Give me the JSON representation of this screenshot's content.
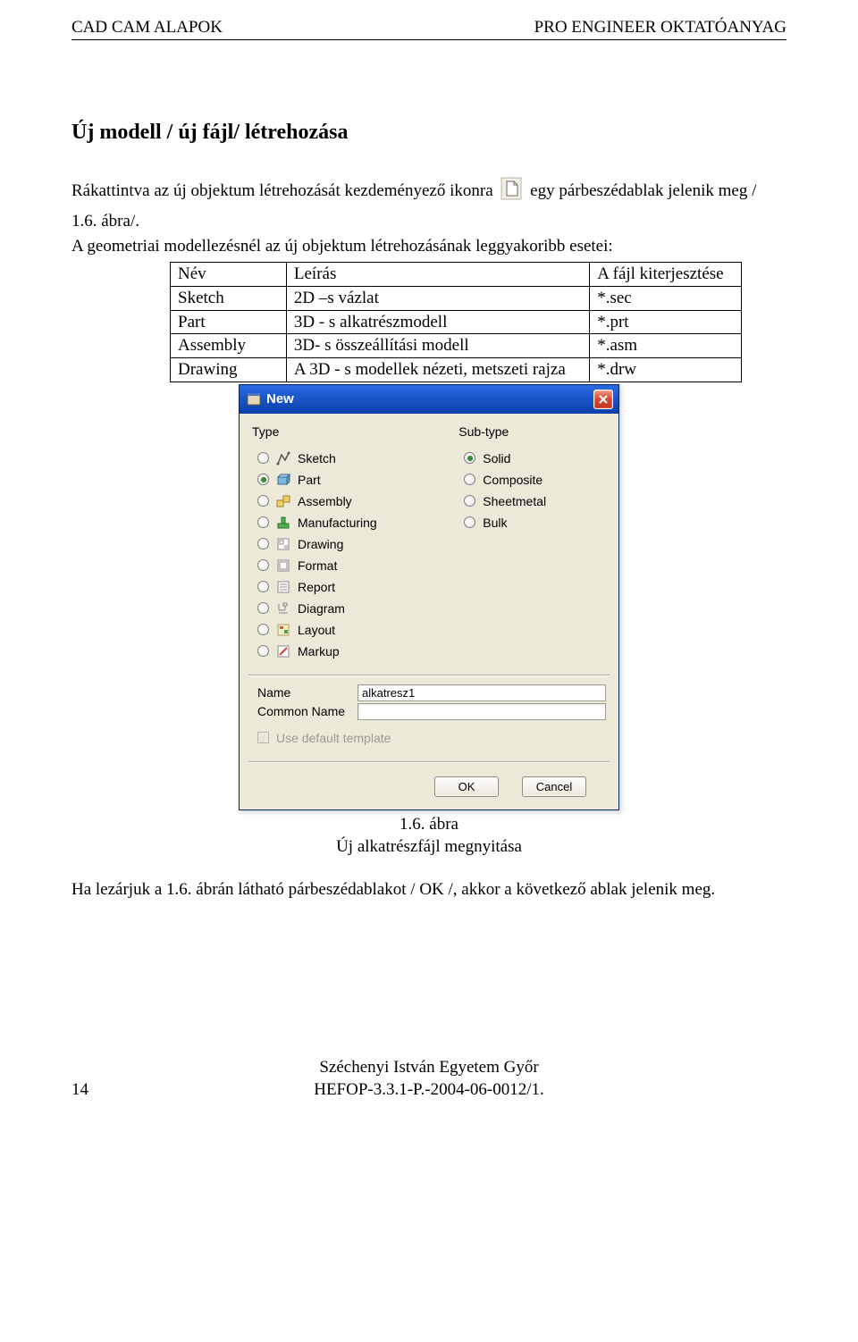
{
  "header": {
    "left": "CAD CAM ALAPOK",
    "right": "PRO ENGINEER OKTATÓANYAG"
  },
  "title": "Új modell / új fájl/ létrehozása",
  "intro": {
    "part1": "Rákattintva az új objektum létrehozását kezdeményező ikonra",
    "part2": "egy párbeszédablak jelenik meg /",
    "line2": "1.6. ábra/.",
    "line3": "A geometriai modellezésnél az új objektum létrehozásának leggyakoribb esetei:"
  },
  "def_table": {
    "rows": [
      {
        "c1": "Név",
        "c2": "Leírás",
        "c3": "A fájl kiterjesztése"
      },
      {
        "c1": "Sketch",
        "c2": "2D –s  vázlat",
        "c3": "*.sec"
      },
      {
        "c1": "Part",
        "c2": "3D - s alkatrészmodell",
        "c3": "*.prt"
      },
      {
        "c1": "Assembly",
        "c2": "3D- s összeállítási modell",
        "c3": "*.asm"
      },
      {
        "c1": "Drawing",
        "c2": "  A 3D - s modellek nézeti, metszeti rajza",
        "c3": "*.drw"
      }
    ]
  },
  "dialog": {
    "title": "New",
    "type_label": "Type",
    "subtype_label": "Sub-type",
    "types": [
      {
        "label": "Sketch",
        "selected": false
      },
      {
        "label": "Part",
        "selected": true
      },
      {
        "label": "Assembly",
        "selected": false
      },
      {
        "label": "Manufacturing",
        "selected": false
      },
      {
        "label": "Drawing",
        "selected": false
      },
      {
        "label": "Format",
        "selected": false
      },
      {
        "label": "Report",
        "selected": false
      },
      {
        "label": "Diagram",
        "selected": false
      },
      {
        "label": "Layout",
        "selected": false
      },
      {
        "label": "Markup",
        "selected": false
      }
    ],
    "subtypes": [
      {
        "label": "Solid",
        "selected": true
      },
      {
        "label": "Composite",
        "selected": false
      },
      {
        "label": "Sheetmetal",
        "selected": false
      },
      {
        "label": "Bulk",
        "selected": false
      }
    ],
    "name_label": "Name",
    "name_value": "alkatresz1",
    "common_label": "Common Name",
    "common_value": "",
    "template_label": "Use default template",
    "ok": "OK",
    "cancel": "Cancel"
  },
  "caption": {
    "line1": "1.6. ábra",
    "line2": "Új alkatrészfájl megnyitása"
  },
  "closing": "Ha lezárjuk a 1.6. ábrán látható párbeszédablakot / OK /, akkor a következő ablak jelenik meg.",
  "footer": {
    "line1": "Széchenyi István Egyetem Győr",
    "line2": "HEFOP-3.3.1-P.-2004-06-0012/1.",
    "page": "14"
  }
}
